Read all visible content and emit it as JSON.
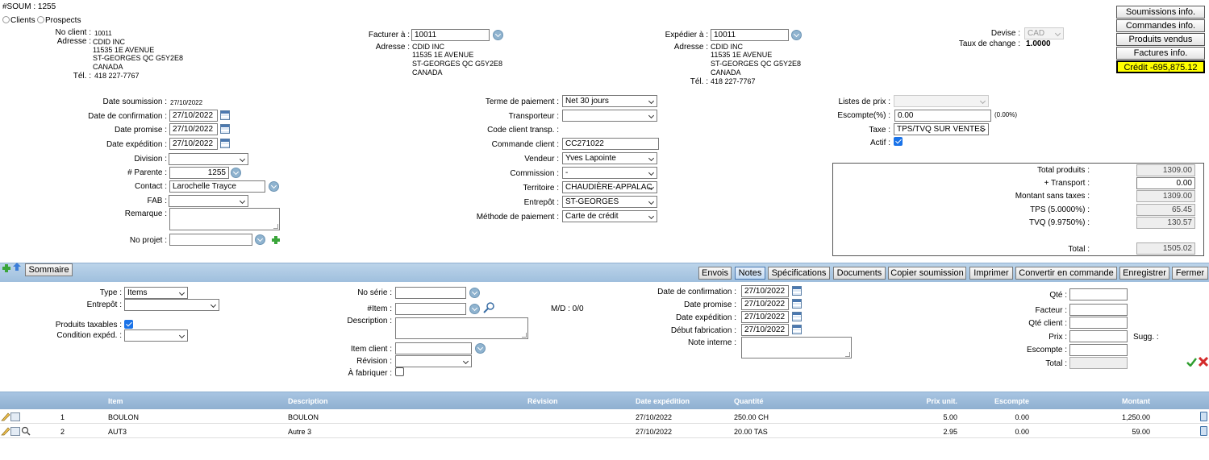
{
  "header": {
    "title": "#SOUM : 1255",
    "radio_clients": "Clients",
    "radio_prospects": "Prospects"
  },
  "client": {
    "no_label": "No client :",
    "no": "10011",
    "address_label": "Adresse :",
    "address": [
      "CDID INC",
      "11535 1E AVENUE",
      "ST-GEORGES QC G5Y2E8",
      "CANADA"
    ],
    "tel_label": "Tél. :",
    "tel": "418 227-7767"
  },
  "billing": {
    "label": "Facturer à :",
    "value": "10011",
    "address_label": "Adresse :",
    "address": [
      "CDID INC",
      "11535 1E AVENUE",
      "ST-GEORGES QC G5Y2E8",
      "CANADA"
    ]
  },
  "shipping": {
    "label": "Expédier à :",
    "value": "10011",
    "address_label": "Adresse :",
    "address": [
      "CDID INC",
      "11535 1E AVENUE",
      "ST-GEORGES QC G5Y2E8",
      "CANADA"
    ],
    "tel_label": "Tél. :",
    "tel": "418 227-7767"
  },
  "currency": {
    "label": "Devise :",
    "value": "CAD",
    "rate_label": "Taux de change :",
    "rate": "1.0000"
  },
  "right_buttons": {
    "submissions": "Soumissions info.",
    "orders": "Commandes info.",
    "products": "Produits vendus",
    "invoices": "Factures info.",
    "credit": "Crédit -695,875.12"
  },
  "form_left": {
    "date_soumission_label": "Date soumission :",
    "date_soumission": "27/10/2022",
    "date_confirmation_label": "Date de confirmation :",
    "date_confirmation": "27/10/2022",
    "date_promise_label": "Date promise :",
    "date_promise": "27/10/2022",
    "date_expedition_label": "Date expédition :",
    "date_expedition": "27/10/2022",
    "division_label": "Division :",
    "division": "",
    "parente_label": "# Parente :",
    "parente": "1255",
    "contact_label": "Contact :",
    "contact": "Larochelle Trayce",
    "fab_label": "FAB :",
    "fab": "",
    "remarque_label": "Remarque :",
    "no_projet_label": "No projet :",
    "no_projet": ""
  },
  "form_mid": {
    "terme_label": "Terme de paiement :",
    "terme": "Net 30 jours",
    "transporteur_label": "Transporteur :",
    "transporteur": "",
    "code_transp_label": "Code client transp. :",
    "commande_client_label": "Commande client :",
    "commande_client": "CC271022",
    "vendeur_label": "Vendeur :",
    "vendeur": "Yves Lapointe",
    "commission_label": "Commission :",
    "commission": "-",
    "territoire_label": "Territoire :",
    "territoire": "CHAUDIÈRE-APPALAC",
    "entrepot_label": "Entrepôt :",
    "entrepot": "ST-GEORGES",
    "methode_label": "Méthode de paiement :",
    "methode": "Carte de crédit"
  },
  "form_right": {
    "listes_prix_label": "Listes de prix :",
    "listes_prix": "",
    "escompte_label": "Escompte(%) :",
    "escompte": "0.00",
    "escompte_pct": "(0.00%)",
    "taxe_label": "Taxe :",
    "taxe": "TPS/TVQ SUR VENTES",
    "actif_label": "Actif :"
  },
  "totals": {
    "total_produits_label": "Total produits :",
    "total_produits": "1309.00",
    "transport_label": "+ Transport :",
    "transport": "0.00",
    "sans_taxes_label": "Montant sans taxes :",
    "sans_taxes": "1309.00",
    "tps_label": "TPS (5.0000%) :",
    "tps": "65.45",
    "tvq_label": "TVQ (9.9750%) :",
    "tvq": "130.57",
    "total_label": "Total :",
    "total": "1505.02"
  },
  "toolbar": {
    "sommaire": "Sommaire",
    "envois": "Envois",
    "notes": "Notes",
    "specifications": "Spécifications",
    "documents": "Documents",
    "copier": "Copier soumission",
    "imprimer": "Imprimer",
    "convertir": "Convertir en commande",
    "enregistrer": "Enregistrer",
    "fermer": "Fermer"
  },
  "item_form": {
    "type_label": "Type :",
    "type": "Items",
    "entrepot_label": "Entrepôt :",
    "entrepot": "",
    "taxables_label": "Produits taxables :",
    "condition_label": "Condition expéd. :",
    "condition": "",
    "no_serie_label": "No série :",
    "item_label": "#Item :",
    "description_label": "Description :",
    "item_client_label": "Item client :",
    "revision_label": "Révision :",
    "a_fabriquer_label": "À fabriquer :",
    "md": "M/D : 0/0",
    "date_conf_label": "Date de confirmation :",
    "date_conf": "27/10/2022",
    "date_prom_label": "Date promise :",
    "date_prom": "27/10/2022",
    "date_exp_label": "Date expédition :",
    "date_exp": "27/10/2022",
    "debut_fab_label": "Début fabrication :",
    "debut_fab": "27/10/2022",
    "note_interne_label": "Note interne :",
    "qte_label": "Qté :",
    "facteur_label": "Facteur :",
    "qte_client_label": "Qté client :",
    "prix_label": "Prix :",
    "sugg_label": "Sugg. :",
    "escompte_label": "Escompte :",
    "total_label": "Total :"
  },
  "table": {
    "headers": {
      "item": "Item",
      "description": "Description",
      "revision": "Révision",
      "date_exp": "Date expédition",
      "quantite": "Quantité",
      "prix": "Prix unit.",
      "escompte": "Escompte",
      "montant": "Montant"
    },
    "rows": [
      {
        "no": "1",
        "item": "BOULON",
        "description": "BOULON",
        "date": "27/10/2022",
        "quantite": "250.00 CH",
        "prix": "5.00",
        "escompte": "0.00",
        "montant": "1,250.00"
      },
      {
        "no": "2",
        "item": "AUT3",
        "description": "Autre 3",
        "date": "27/10/2022",
        "quantite": "20.00 TAS",
        "prix": "2.95",
        "escompte": "0.00",
        "montant": "59.00"
      }
    ]
  },
  "colors": {
    "credit_bg": "#ffff00",
    "toolbar_blue": "#9fbfdd",
    "table_header": "#8fb0d0"
  }
}
